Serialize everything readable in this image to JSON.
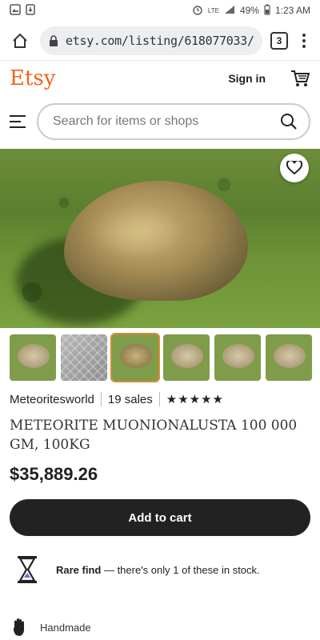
{
  "status_bar": {
    "battery": "49%",
    "time": "1:23 AM",
    "network": "LTE"
  },
  "browser": {
    "url": "etsy.com/listing/618077033/",
    "tab_count": "3"
  },
  "header": {
    "logo": "Etsy",
    "sign_in": "Sign in"
  },
  "search": {
    "placeholder": "Search for items or shops"
  },
  "listing": {
    "shop_name": "Meteoritesworld",
    "sales": "19 sales",
    "rating": "★★★★★",
    "title": "METEORITE MUONIONALUSTA 100 000 GM, 100KG",
    "price": "$35,889.26",
    "add_to_cart": "Add to cart",
    "rare_find_label": "Rare find",
    "rare_find_text": " — there's only 1 of these in stock.",
    "handmade": "Handmade"
  },
  "colors": {
    "brand": "#f1641e",
    "button_bg": "#222222"
  }
}
